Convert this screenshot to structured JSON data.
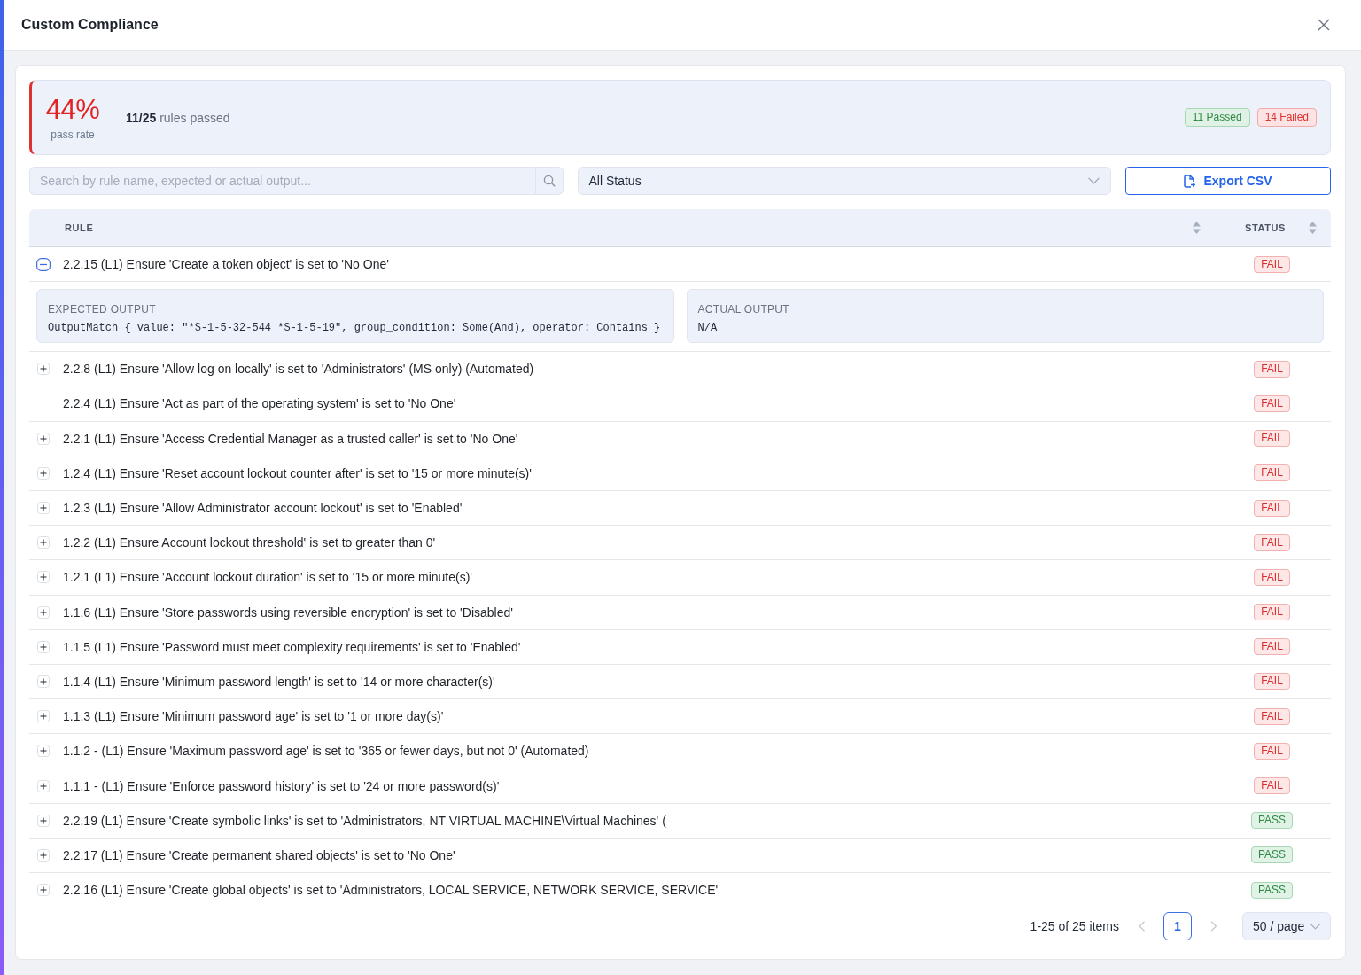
{
  "dialog": {
    "title": "Custom Compliance"
  },
  "summary": {
    "pass_rate": "44%",
    "pass_rate_label": "pass rate",
    "rules_passed": "**11/25** rules passed",
    "counts": [
      {
        "label": "11 Passed",
        "kind": "pass"
      },
      {
        "label": "14 Failed",
        "kind": "fail"
      }
    ]
  },
  "toolbar": {
    "search": {
      "placeholder": "Search by rule name, expected or actual output..."
    },
    "status_filter": {
      "value": "All Status"
    },
    "export_button": {
      "label": "Export CSV"
    }
  },
  "table": {
    "columns": [
      {
        "label": "RULE",
        "sortable": true
      },
      {
        "label": "STATUS",
        "sortable": true
      }
    ],
    "rows": [
      {
        "rule": "2.2.15 (L1) Ensure 'Create a token object' is set to 'No One'",
        "status": {
          "label": "FAIL",
          "kind": "fail"
        },
        "expandable": true,
        "expanded": true,
        "details": [
          {
            "label": "EXPECTED OUTPUT",
            "value": "OutputMatch { value: \"*S-1-5-32-544 *S-1-5-19\", group_condition: Some(And), operator: Contains }"
          },
          {
            "label": "ACTUAL OUTPUT",
            "value": "N/A"
          }
        ]
      },
      {
        "rule": "2.2.8 (L1) Ensure 'Allow log on locally' is set to 'Administrators' (MS only) (Automated)",
        "status": {
          "label": "FAIL",
          "kind": "fail"
        },
        "expandable": true,
        "expanded": false
      },
      {
        "rule": "2.2.4 (L1) Ensure 'Act as part of the operating system' is set to 'No One'",
        "status": {
          "label": "FAIL",
          "kind": "fail"
        },
        "expandable": false
      },
      {
        "rule": "2.2.1 (L1) Ensure 'Access Credential Manager as a trusted caller' is set to 'No One'",
        "status": {
          "label": "FAIL",
          "kind": "fail"
        },
        "expandable": true,
        "expanded": false
      },
      {
        "rule": "1.2.4 (L1) Ensure 'Reset account lockout counter after' is set to '15 or more minute(s)'",
        "status": {
          "label": "FAIL",
          "kind": "fail"
        },
        "expandable": true,
        "expanded": false
      },
      {
        "rule": "1.2.3 (L1) Ensure 'Allow Administrator account lockout' is set to 'Enabled'",
        "status": {
          "label": "FAIL",
          "kind": "fail"
        },
        "expandable": true,
        "expanded": false
      },
      {
        "rule": "1.2.2 (L1) Ensure Account lockout threshold' is set to greater than 0'",
        "status": {
          "label": "FAIL",
          "kind": "fail"
        },
        "expandable": true,
        "expanded": false
      },
      {
        "rule": "1.2.1 (L1) Ensure 'Account lockout duration' is set to '15 or more minute(s)'",
        "status": {
          "label": "FAIL",
          "kind": "fail"
        },
        "expandable": true,
        "expanded": false
      },
      {
        "rule": "1.1.6 (L1) Ensure 'Store passwords using reversible encryption' is set to 'Disabled'",
        "status": {
          "label": "FAIL",
          "kind": "fail"
        },
        "expandable": true,
        "expanded": false
      },
      {
        "rule": "1.1.5 (L1) Ensure 'Password must meet complexity requirements' is set to 'Enabled'",
        "status": {
          "label": "FAIL",
          "kind": "fail"
        },
        "expandable": true,
        "expanded": false
      },
      {
        "rule": "1.1.4 (L1) Ensure 'Minimum password length' is set to '14 or more character(s)'",
        "status": {
          "label": "FAIL",
          "kind": "fail"
        },
        "expandable": true,
        "expanded": false
      },
      {
        "rule": "1.1.3 (L1) Ensure 'Minimum password age' is set to '1 or more day(s)'",
        "status": {
          "label": "FAIL",
          "kind": "fail"
        },
        "expandable": true,
        "expanded": false
      },
      {
        "rule": "1.1.2 - (L1) Ensure 'Maximum password age' is set to '365 or fewer days, but not 0' (Automated)",
        "status": {
          "label": "FAIL",
          "kind": "fail"
        },
        "expandable": true,
        "expanded": false
      },
      {
        "rule": "1.1.1 - (L1) Ensure 'Enforce password history' is set to '24 or more password(s)'",
        "status": {
          "label": "FAIL",
          "kind": "fail"
        },
        "expandable": true,
        "expanded": false
      },
      {
        "rule": "2.2.19 (L1) Ensure 'Create symbolic links' is set to 'Administrators, NT VIRTUAL MACHINE\\Virtual Machines' (",
        "status": {
          "label": "PASS",
          "kind": "pass"
        },
        "expandable": true,
        "expanded": false
      },
      {
        "rule": "2.2.17 (L1) Ensure 'Create permanent shared objects' is set to 'No One'",
        "status": {
          "label": "PASS",
          "kind": "pass"
        },
        "expandable": true,
        "expanded": false
      },
      {
        "rule": "2.2.16 (L1) Ensure 'Create global objects' is set to 'Administrators, LOCAL SERVICE, NETWORK SERVICE, SERVICE'",
        "status": {
          "label": "PASS",
          "kind": "pass"
        },
        "expandable": true,
        "expanded": false
      }
    ]
  },
  "pagination": {
    "range": "1-25 of 25 items",
    "prev": {
      "disabled": true
    },
    "pages": [
      {
        "label": "1",
        "selected": true
      }
    ],
    "next": {
      "disabled": true
    },
    "page_size": "50 / page"
  }
}
